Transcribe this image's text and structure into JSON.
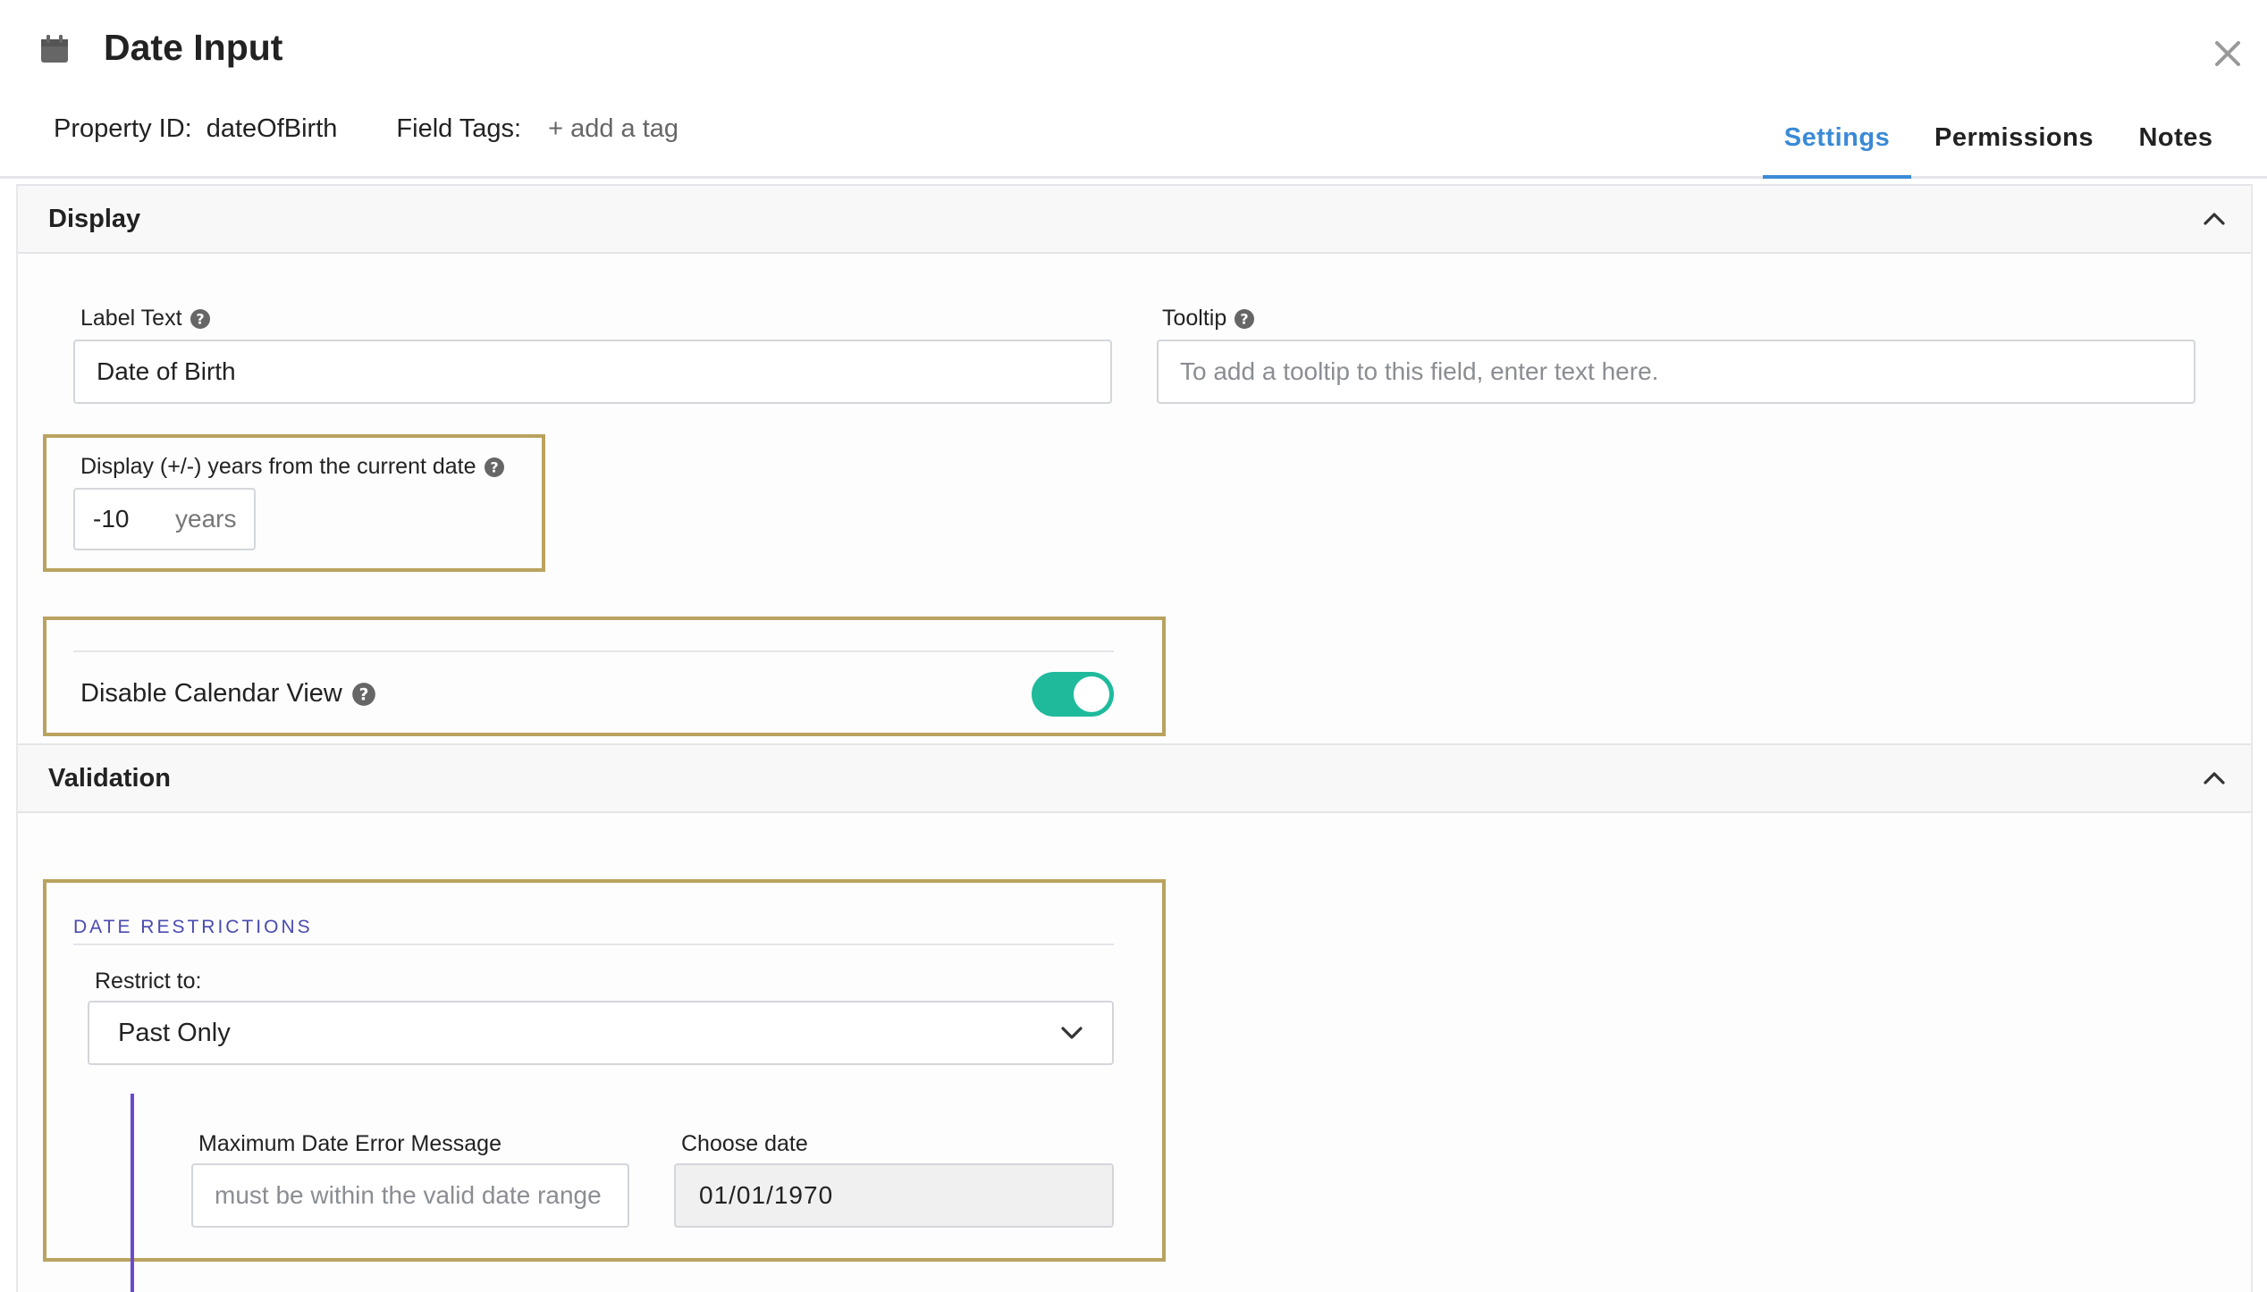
{
  "header": {
    "title": "Date Input",
    "icon": "calendar-icon",
    "property_id_label": "Property ID:",
    "property_id_value": "dateOfBirth",
    "field_tags_label": "Field Tags:",
    "add_tag": "+ add a tag",
    "tabs": [
      {
        "label": "Settings",
        "active": true
      },
      {
        "label": "Permissions",
        "active": false
      },
      {
        "label": "Notes",
        "active": false
      }
    ],
    "accent_color": "#3a8ad6"
  },
  "display": {
    "title": "Display",
    "label_text": {
      "label": "Label Text",
      "value": "Date of Birth"
    },
    "tooltip": {
      "label": "Tooltip",
      "placeholder": "To add a tooltip to this field, enter text here."
    },
    "years_range": {
      "label": "Display (+/-) years from the current date",
      "value": "-10",
      "unit": "years"
    },
    "disable_calendar": {
      "label": "Disable Calendar View",
      "enabled": true,
      "toggle_color": "#1fba9c"
    }
  },
  "validation": {
    "title": "Validation",
    "section_caption": "DATE RESTRICTIONS",
    "restrict_to": {
      "label": "Restrict to:",
      "selected": "Past Only"
    },
    "max_error": {
      "label": "Maximum Date Error Message",
      "placeholder": "must be within the valid date range"
    },
    "choose_date": {
      "label": "Choose date",
      "value": "01/01/1970"
    }
  },
  "highlight_color": "#b9a35f"
}
